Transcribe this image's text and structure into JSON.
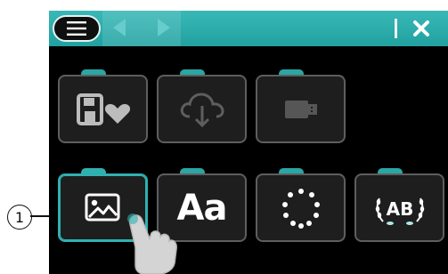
{
  "callout": {
    "number": "1"
  },
  "tiles": {
    "row1": [
      {
        "name": "favorites-tile",
        "icon": "save-favorite-icon"
      },
      {
        "name": "cloud-download-tile",
        "icon": "cloud-download-icon"
      },
      {
        "name": "usb-tile",
        "icon": "usb-drive-icon"
      }
    ],
    "row2": [
      {
        "name": "image-tile",
        "icon": "image-icon",
        "active": true
      },
      {
        "name": "text-tile",
        "icon": "text-icon",
        "label": "Aa"
      },
      {
        "name": "frame-tile",
        "icon": "dot-frame-icon"
      },
      {
        "name": "monogram-tile",
        "icon": "monogram-icon",
        "label": "AB"
      }
    ]
  },
  "colors": {
    "accent": "#2fb1b0",
    "bar": "#39b8b7",
    "screen": "#000000"
  }
}
